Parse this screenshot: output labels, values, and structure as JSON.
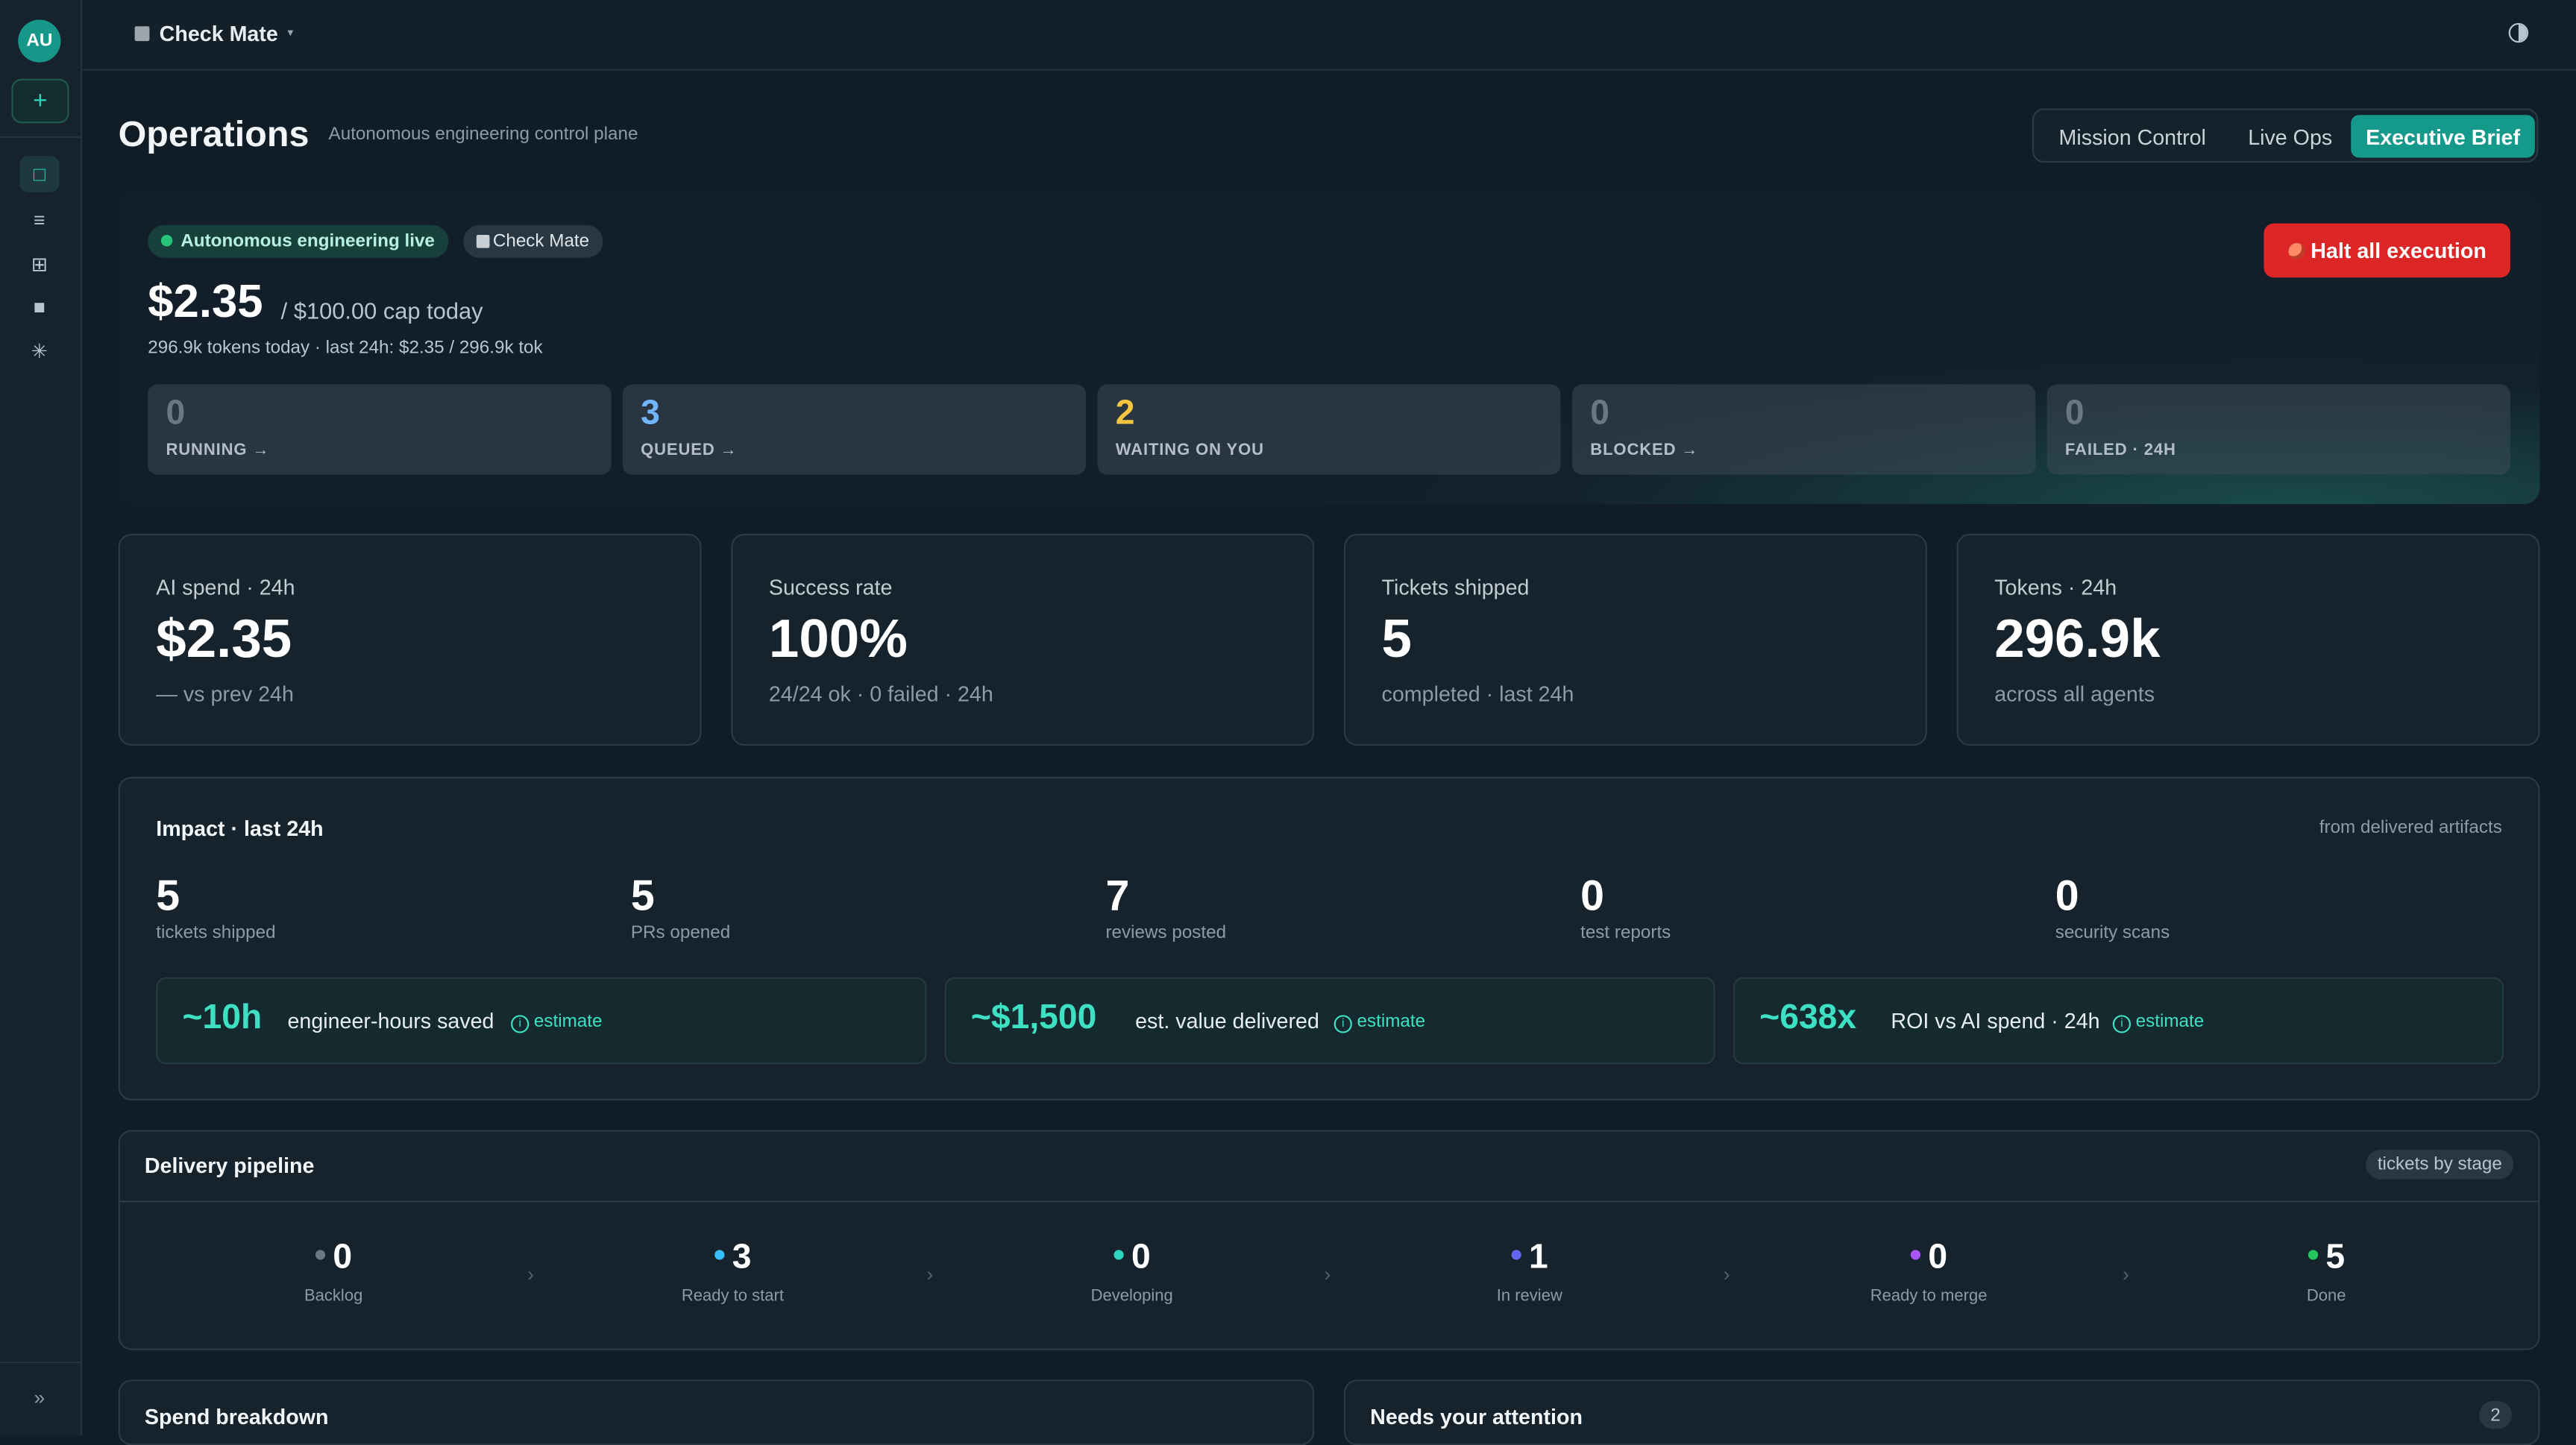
{
  "sidebar": {
    "avatar": "AU",
    "new_label": "+",
    "nav": [
      "□",
      "≡",
      "⊞",
      "■",
      "✳"
    ],
    "expand": "»"
  },
  "topbar": {
    "workspace": "Check Mate",
    "caret": "▾"
  },
  "page": {
    "title": "Operations",
    "subtitle": "Autonomous engineering control plane",
    "tabs": [
      {
        "label": "Mission Control",
        "active": false
      },
      {
        "label": "Live Ops",
        "active": false
      },
      {
        "label": "Executive Brief",
        "active": true
      }
    ]
  },
  "hero": {
    "live_pill": "Autonomous engineering live",
    "workspace_pill": "Check Mate",
    "halt_label": "Halt all execution",
    "spend": "$2.35",
    "cap": "/ $100.00 cap today",
    "tokens_line": "296.9k tokens today  ·  last 24h: $2.35 / 296.9k tok",
    "stats": [
      {
        "value": "0",
        "label": "RUNNING →",
        "color": "#6b7780"
      },
      {
        "value": "3",
        "label": "QUEUED →",
        "color": "#6fb6ff"
      },
      {
        "value": "2",
        "label": "WAITING ON YOU",
        "color": "#f5c542"
      },
      {
        "value": "0",
        "label": "BLOCKED →",
        "color": "#6b7780"
      },
      {
        "value": "0",
        "label": "FAILED · 24H",
        "color": "#6b7780"
      }
    ]
  },
  "kpis": [
    {
      "label": "AI spend · 24h",
      "value": "$2.35",
      "sub": "— vs prev 24h"
    },
    {
      "label": "Success rate",
      "value": "100%",
      "sub": "24/24 ok · 0 failed · 24h"
    },
    {
      "label": "Tickets shipped",
      "value": "5",
      "sub": "completed · last 24h"
    },
    {
      "label": "Tokens · 24h",
      "value": "296.9k",
      "sub": "across all agents"
    }
  ],
  "impact": {
    "title": "Impact · last 24h",
    "note": "from delivered artifacts",
    "stats": [
      {
        "value": "5",
        "label": "tickets shipped"
      },
      {
        "value": "5",
        "label": "PRs opened"
      },
      {
        "value": "7",
        "label": "reviews posted"
      },
      {
        "value": "0",
        "label": "test reports"
      },
      {
        "value": "0",
        "label": "security scans"
      }
    ],
    "estimates": [
      {
        "value": "~10h",
        "label": "engineer-hours saved",
        "tag": "estimate"
      },
      {
        "value": "~$1,500",
        "label": "est. value delivered",
        "tag": "estimate"
      },
      {
        "value": "~638x",
        "label": "ROI vs AI spend · 24h",
        "tag": "estimate"
      }
    ]
  },
  "pipeline": {
    "title": "Delivery pipeline",
    "badge": "tickets by stage",
    "stages": [
      {
        "value": "0",
        "label": "Backlog",
        "color": "#6b7780"
      },
      {
        "value": "3",
        "label": "Ready to start",
        "color": "#38bdf8"
      },
      {
        "value": "0",
        "label": "Developing",
        "color": "#2dd4bf"
      },
      {
        "value": "1",
        "label": "In review",
        "color": "#6366f1"
      },
      {
        "value": "0",
        "label": "Ready to merge",
        "color": "#a855f7"
      },
      {
        "value": "5",
        "label": "Done",
        "color": "#22c55e"
      }
    ],
    "chevron": "›"
  },
  "bottom": {
    "spend_title": "Spend breakdown",
    "attention_title": "Needs your attention",
    "attention_count": "2"
  }
}
